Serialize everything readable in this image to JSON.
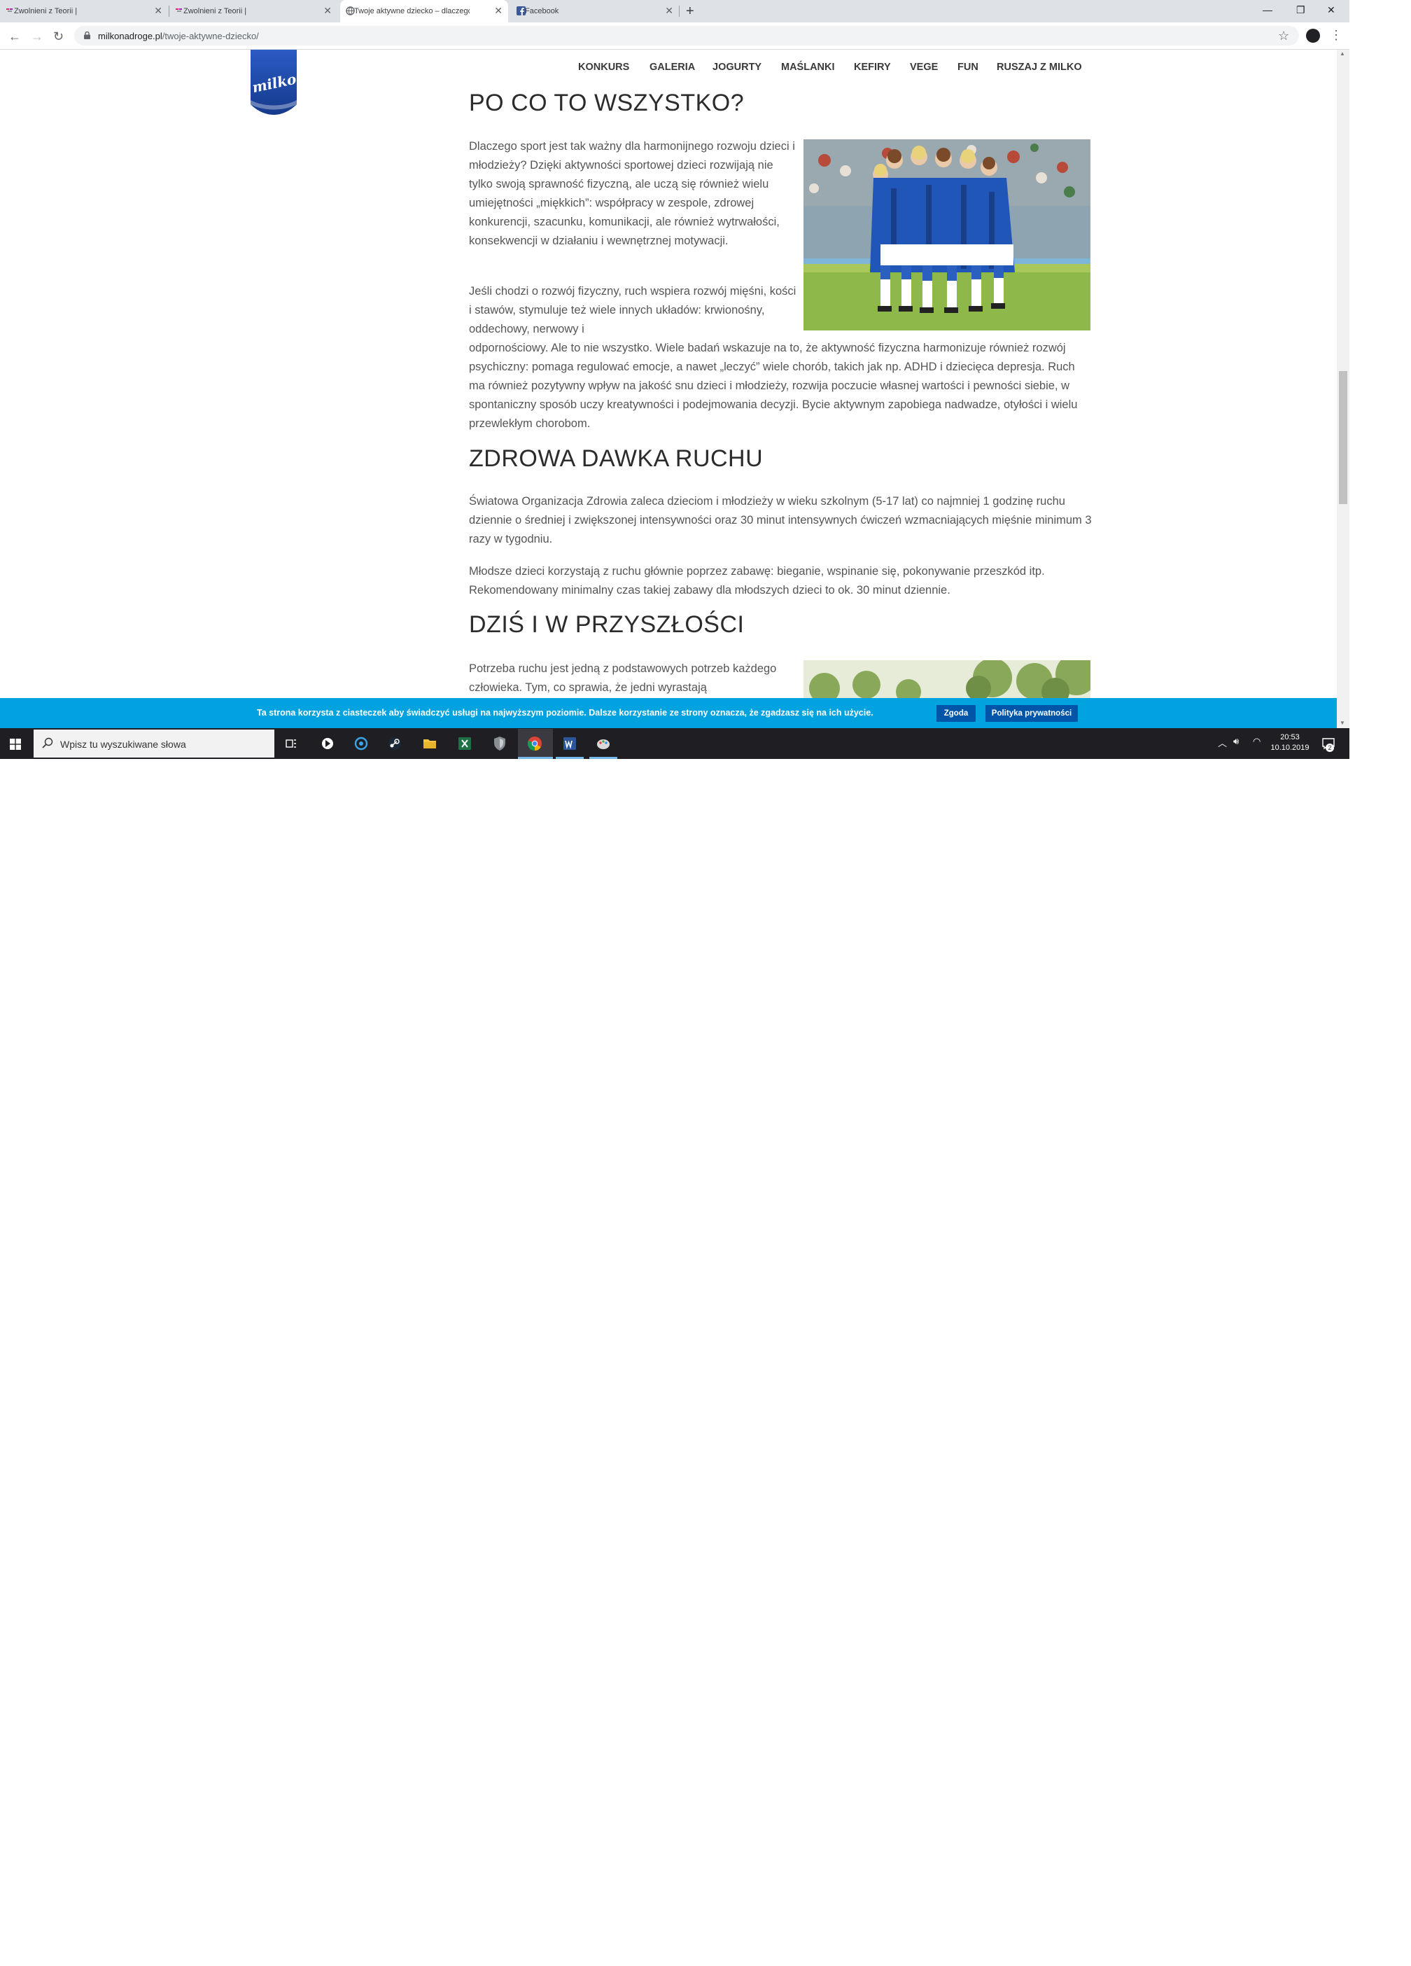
{
  "browser": {
    "tabs": [
      {
        "title": "Zwolnieni z Teorii |"
      },
      {
        "title": "Zwolnieni z Teorii |"
      },
      {
        "title": "Twoje aktywne dziecko – dlaczego"
      },
      {
        "title": "Facebook"
      }
    ],
    "url_domain": "milkonadroge.pl",
    "url_path": "/twoje-aktywne-dziecko/"
  },
  "site": {
    "logo_text": "milko",
    "nav": [
      "KONKURS",
      "GALERIA",
      "JOGURTY",
      "MAŚLANKI",
      "KEFIRY",
      "VEGE",
      "FUN",
      "RUSZAJ Z MILKO"
    ]
  },
  "article": {
    "h1": "PO CO TO WSZYSTKO?",
    "p1": "Dlaczego sport jest tak ważny dla harmonijnego rozwoju dzieci i młodzieży? Dzięki aktywności sportowej dzieci rozwijają nie tylko swoją sprawność fizyczną, ale uczą się również wielu umiejętności „miękkich”: współpracy w zespole, zdrowej konkurencji, szacunku, komunikacji, ale również wytrwałości, konsekwencji w działaniu i wewnętrznej motywacji.",
    "p2a": "Jeśli chodzi o rozwój fizyczny, ruch wspiera rozwój mięśni, kości i stawów, stymuluje też wiele innych układów: krwionośny, oddechowy, nerwowy i",
    "p2b": "odpornościowy. Ale to nie wszystko. Wiele badań wskazuje na to, że aktywność fizyczna harmonizuje również rozwój psychiczny: pomaga regulować emocje, a nawet „leczyć” wiele chorób, takich jak np. ADHD i dziecięca depresja. Ruch ma również pozytywny wpływ na jakość snu dzieci i młodzieży, rozwija poczucie własnej wartości i pewności siebie, w spontaniczny sposób uczy kreatywności i podejmowania decyzji. Bycie aktywnym zapobiega nadwadze, otyłości i wielu przewlekłym chorobom.",
    "h2": "ZDROWA DAWKA RUCHU",
    "p3": "Światowa Organizacja Zdrowia zaleca dzieciom i młodzieży w wieku szkolnym (5-17 lat) co najmniej 1 godzinę ruchu dziennie o średniej i zwiększonej intensywności oraz 30 minut intensywnych ćwiczeń wzmacniających mięśnie minimum 3 razy w tygodniu.",
    "p4": "Młodsze dzieci korzystają z ruchu głównie poprzez zabawę: bieganie, wspinanie się, pokonywanie przeszkód itp. Rekomendowany minimalny czas takiej zabawy dla młodszych dzieci to ok. 30 minut dziennie.",
    "h3": "DZIŚ I W PRZYSZŁOŚCI",
    "p5": "Potrzeba ruchu jest jedną z podstawowych potrzeb każdego człowieka. Tym, co sprawia, że jedni wyrastają"
  },
  "cookie": {
    "text": "Ta strona korzysta z ciasteczek aby świadczyć usługi na najwyższym poziomie. Dalsze korzystanie ze strony oznacza, że zgadzasz się na ich użycie.",
    "accept": "Zgoda",
    "policy": "Polityka prywatności"
  },
  "taskbar": {
    "search_placeholder": "Wpisz tu wyszukiwane słowa",
    "time": "20:53",
    "date": "10.10.2019",
    "notifications": "2"
  },
  "colors": {
    "brand_blue": "#1d4aa8",
    "cookie_bar": "#00a3e0",
    "taskbar": "#1f1f23"
  }
}
